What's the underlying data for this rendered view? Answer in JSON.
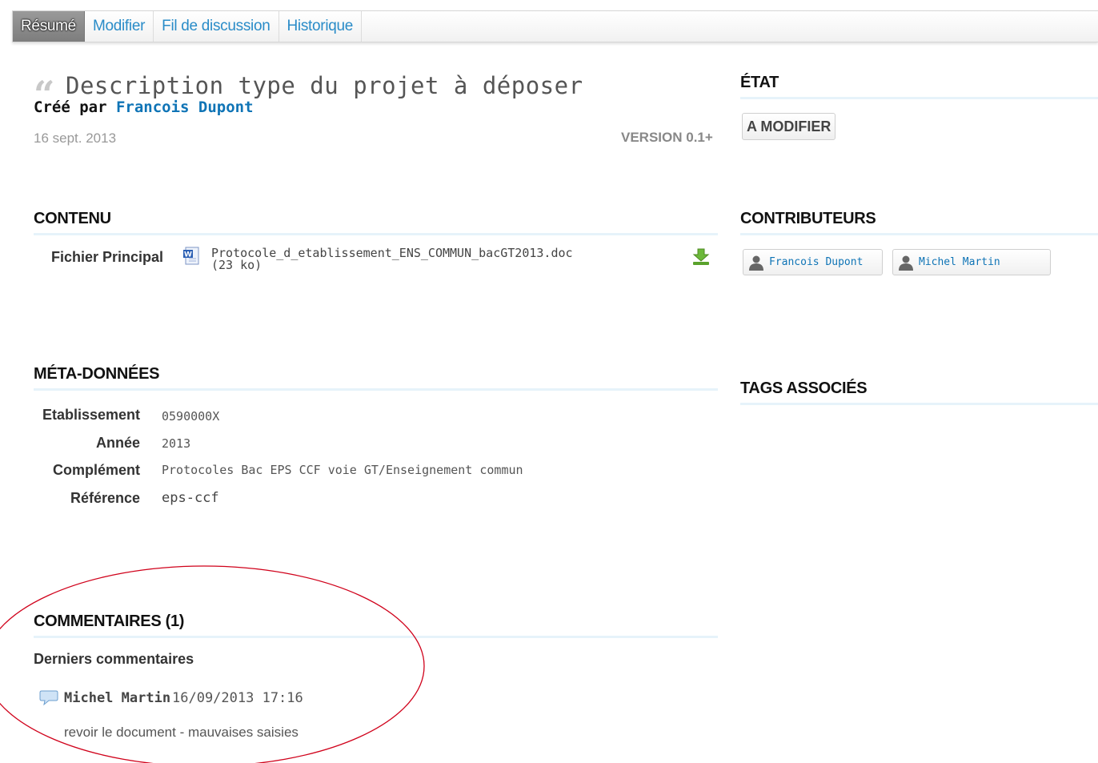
{
  "tabs": [
    {
      "label": "Résumé",
      "active": true
    },
    {
      "label": "Modifier"
    },
    {
      "label": "Fil de discussion"
    },
    {
      "label": "Historique"
    }
  ],
  "doc": {
    "title": "Description type du projet à déposer",
    "created_by_prefix": "Créé par",
    "author": "Francois Dupont",
    "date": "16 sept. 2013",
    "version": "VERSION 0.1+"
  },
  "contenu": {
    "heading": "CONTENU",
    "file_label": "Fichier Principal",
    "file_name": "Protocole_d_etablissement_ENS_COMMUN_bacGT2013.doc",
    "file_size": "(23 ko)"
  },
  "meta": {
    "heading": "MÉTA-DONNÉES",
    "rows": [
      {
        "label": "Etablissement",
        "value": "0590000X"
      },
      {
        "label": "Année",
        "value": "2013"
      },
      {
        "label": "Complément",
        "value": "Protocoles Bac EPS CCF voie GT/Enseignement commun"
      },
      {
        "label": "Référence",
        "value": "eps-ccf"
      }
    ]
  },
  "comments": {
    "heading": "COMMENTAIRES (1)",
    "subheading": "Derniers commentaires",
    "items": [
      {
        "author": "Michel Martin",
        "datetime": "16/09/2013 17:16",
        "text": "revoir le document - mauvaises saisies"
      }
    ]
  },
  "sidebar": {
    "etat_heading": "ÉTAT",
    "etat_value": "A MODIFIER",
    "contrib_heading": "CONTRIBUTEURS",
    "contributors": [
      "Francois Dupont",
      "Michel Martin"
    ],
    "tags_heading": "TAGS ASSOCIÉS"
  },
  "colors": {
    "link": "#0f74b6",
    "tab_link": "#2a8cc8",
    "rule": "#e6f3fa",
    "annotation": "#d0021b"
  },
  "icons": [
    "quote-icon",
    "word-doc-icon",
    "download-icon",
    "comment-bubble-icon",
    "user-icon"
  ]
}
